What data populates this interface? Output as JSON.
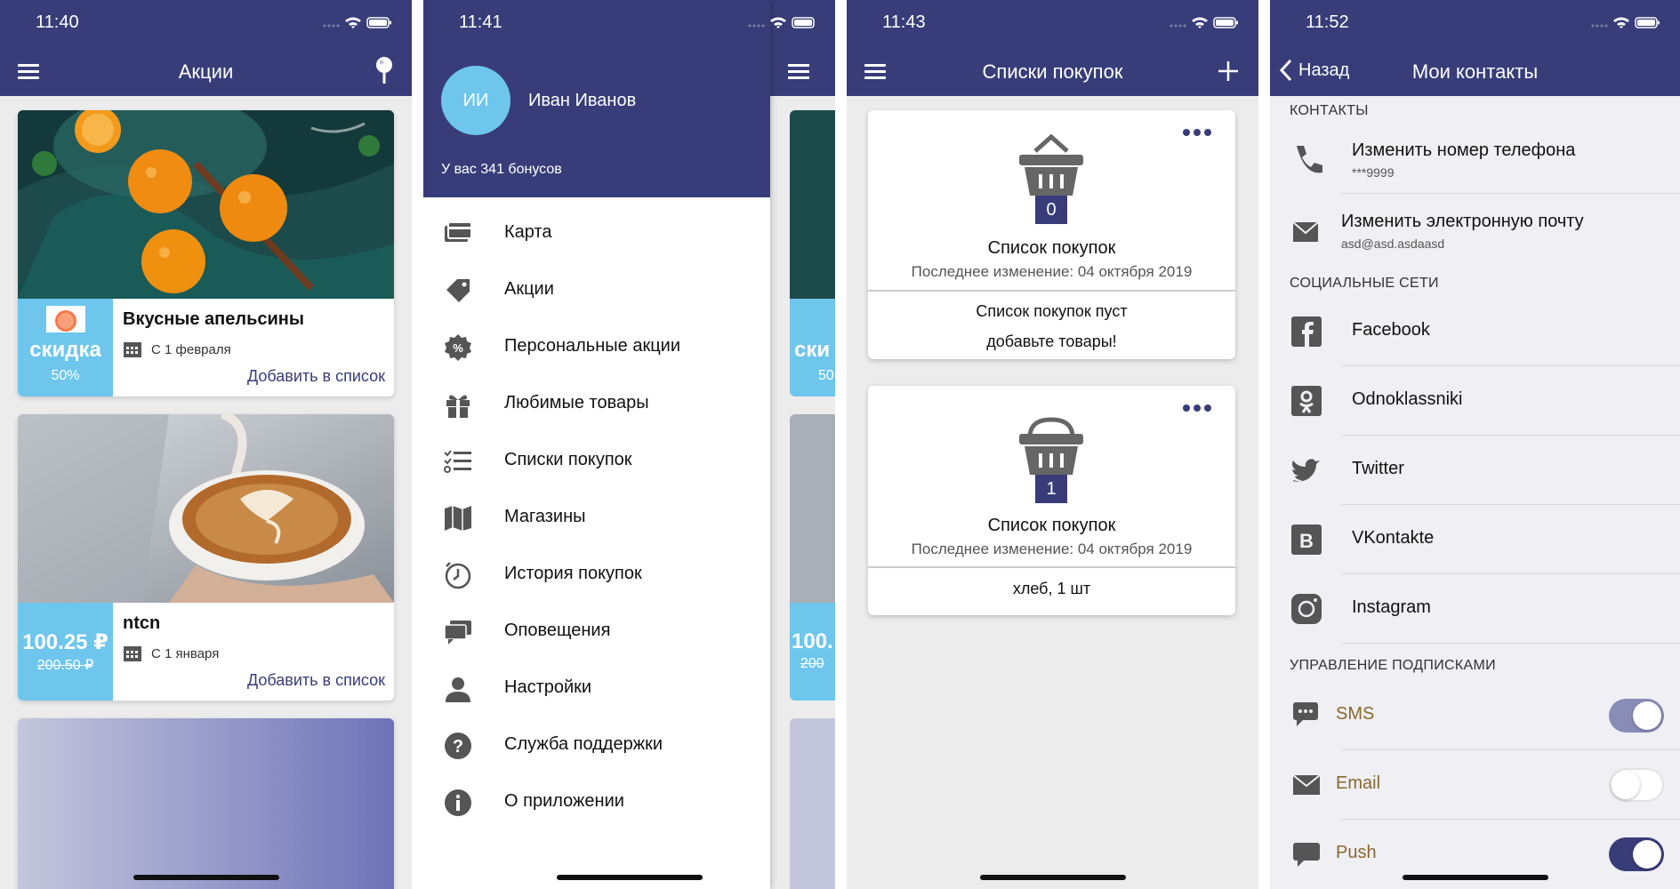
{
  "screens": {
    "promos": {
      "time": "11:40",
      "title": "Акции",
      "cards": [
        {
          "name": "Вкусные апельсины",
          "badge_main": "скидка",
          "badge_sub": "50%",
          "date": "С 1 февраля",
          "add": "Добавить в список"
        },
        {
          "name": "ntcn",
          "badge_main": "100.25 ₽",
          "badge_sub": "200.50 ₽",
          "date": "С 1 января",
          "add": "Добавить в список"
        }
      ]
    },
    "menu": {
      "time": "11:41",
      "avatar_initials": "ИИ",
      "user_name": "Иван Иванов",
      "bonus_text": "У вас 341 бонусов",
      "items": [
        {
          "label": "Карта",
          "icon": "card-icon"
        },
        {
          "label": "Акции",
          "icon": "tag-icon"
        },
        {
          "label": "Персональные акции",
          "icon": "percent-badge-icon"
        },
        {
          "label": "Любимые товары",
          "icon": "gift-icon"
        },
        {
          "label": "Списки покупок",
          "icon": "checklist-icon"
        },
        {
          "label": "Магазины",
          "icon": "map-icon"
        },
        {
          "label": "История покупок",
          "icon": "clock-icon"
        },
        {
          "label": "Оповещения",
          "icon": "chat-icon"
        },
        {
          "label": "Настройки",
          "icon": "person-icon"
        },
        {
          "label": "Служба поддержки",
          "icon": "help-icon"
        },
        {
          "label": "О приложении",
          "icon": "info-icon"
        }
      ],
      "behind_badge_main": "ски",
      "behind_badge_sub": "50",
      "behind_price_main": "100.",
      "behind_price_sub": "200"
    },
    "lists": {
      "time": "11:43",
      "title": "Списки покупок",
      "lists": [
        {
          "count": "0",
          "name": "Список покупок",
          "modified": "Последнее изменение: 04 октября 2019",
          "body_lines": [
            "Список покупок пуст",
            "добавьте товары!"
          ]
        },
        {
          "count": "1",
          "name": "Список покупок",
          "modified": "Последнее изменение: 04 октября 2019",
          "body_lines": [
            "хлеб, 1 шт"
          ]
        }
      ]
    },
    "contacts": {
      "time": "11:52",
      "back_label": "Назад",
      "title": "Мои контакты",
      "section_contacts": "КОНТАКТЫ",
      "phone_label": "Изменить номер телефона",
      "phone_value": "***9999",
      "email_label": "Изменить электронную почту",
      "email_value": "asd@asd.asdaasd",
      "section_social": "СОЦИАЛЬНЫЕ СЕТИ",
      "social": [
        {
          "label": "Facebook",
          "icon": "facebook-icon"
        },
        {
          "label": "Odnoklassniki",
          "icon": "odnoklassniki-icon"
        },
        {
          "label": "Twitter",
          "icon": "twitter-icon"
        },
        {
          "label": "VKontakte",
          "icon": "vk-icon"
        },
        {
          "label": "Instagram",
          "icon": "instagram-icon"
        }
      ],
      "section_subs": "УПРАВЛЕНИЕ ПОДПИСКАМИ",
      "subscriptions": [
        {
          "label": "SMS",
          "enabled": true,
          "disabled_look": true
        },
        {
          "label": "Email",
          "enabled": false
        },
        {
          "label": "Push",
          "enabled": true
        }
      ]
    }
  },
  "colors": {
    "primary": "#383D79",
    "accent_blue": "#6EC6EC",
    "link_gold": "#8A6A2E"
  }
}
